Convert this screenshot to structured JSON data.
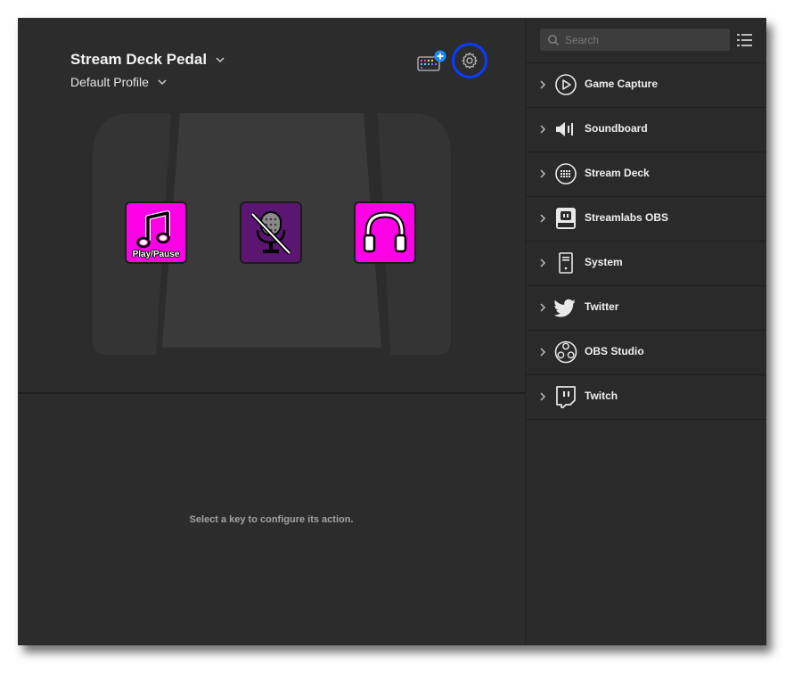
{
  "device": {
    "name": "Stream Deck Pedal",
    "profile": "Default Profile"
  },
  "keys": [
    {
      "label": "Play/Pause",
      "icon": "music-note-icon",
      "color": "#ff00e6"
    },
    {
      "label": "",
      "icon": "microphone-muted-icon",
      "color": "#5a1670"
    },
    {
      "label": "",
      "icon": "headphones-icon",
      "color": "#ff00e6"
    }
  ],
  "hint": "Select a key to configure its action.",
  "search": {
    "placeholder": "Search",
    "value": ""
  },
  "categories": [
    {
      "label": "Game Capture",
      "icon": "play-circle-icon"
    },
    {
      "label": "Soundboard",
      "icon": "speaker-icon"
    },
    {
      "label": "Stream Deck",
      "icon": "stream-deck-icon"
    },
    {
      "label": "Streamlabs OBS",
      "icon": "streamlabs-icon"
    },
    {
      "label": "System",
      "icon": "pc-tower-icon"
    },
    {
      "label": "Twitter",
      "icon": "twitter-bird-icon"
    },
    {
      "label": "OBS Studio",
      "icon": "obs-logo-icon"
    },
    {
      "label": "Twitch",
      "icon": "twitch-logo-icon"
    }
  ],
  "colors": {
    "accent": "#0a3cff",
    "key_pink": "#ff00e6",
    "key_purple": "#5a1670",
    "badge_blue": "#1c8cff"
  }
}
